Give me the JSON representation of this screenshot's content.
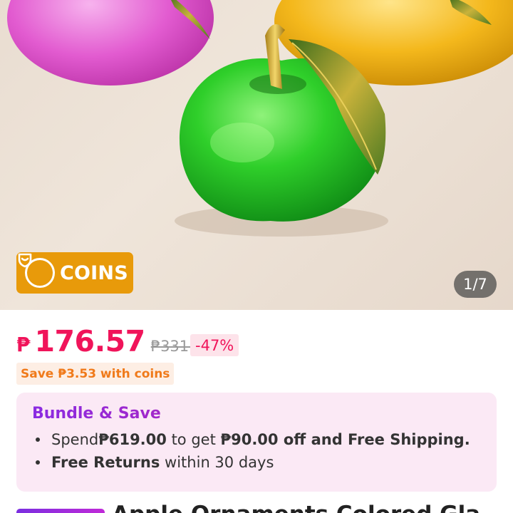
{
  "gallery": {
    "image_label": "",
    "counter": "1/7"
  },
  "coins_badge": {
    "icon": "coin-heart-icon",
    "label": "COINS",
    "color": "#e89a0a"
  },
  "price": {
    "currency": "₱",
    "current": "176.57",
    "original": "₱331.06",
    "discount": "-47%",
    "accent": "#f0145a"
  },
  "coins_saving": "Save ₱3.53 with coins",
  "bundle": {
    "title": "Bundle & Save",
    "line1": {
      "pre": "Spend ",
      "amount": "₱619.00",
      "mid": " to get ",
      "offer": "₱90.00 off and Free Shipping."
    },
    "line2": {
      "strong": "Free Returns",
      "rest": " within 30 days"
    }
  },
  "product_title": "Apple Ornaments Colored Gla"
}
